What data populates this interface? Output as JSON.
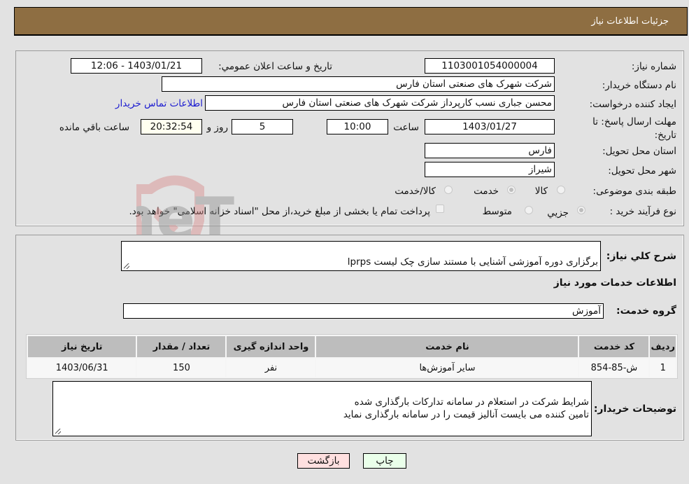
{
  "header": {
    "title": "جزئیات اطلاعات نیاز"
  },
  "fields": {
    "need_number_label": "شماره نیاز:",
    "need_number": "1103001054000004",
    "announce_label": "تاریخ و ساعت اعلان عمومي:",
    "announce_value": "1403/01/21 - 12:06",
    "buyer_org_label": "نام دستگاه خریدار:",
    "buyer_org": "شرکت شهرک های صنعتی استان فارس",
    "creator_label": "ایجاد کننده درخواست:",
    "creator": "محسن  جباری نسب کارپرداز شرکت شهرک های صنعتی استان فارس",
    "contact_link": "اطلاعات تماس خریدار",
    "deadline_label": "مهلت ارسال پاسخ: تا تاریخ:",
    "deadline_date": "1403/01/27",
    "time_label": "ساعت",
    "deadline_time": "10:00",
    "days_value": "5",
    "days_label": "روز و",
    "remaining_time": "20:32:54",
    "remaining_label": "ساعت باقي مانده",
    "province_label": "استان محل تحویل:",
    "province": "فارس",
    "city_label": "شهر محل تحویل:",
    "city": "شیراز",
    "category_label": "طبقه بندی موضوعی:",
    "category_options": [
      "کالا",
      "خدمت",
      "کالا/خدمت"
    ],
    "category_selected": "خدمت",
    "process_label": "نوع فرآیند خرید :",
    "process_options": [
      "جزیي",
      "متوسط"
    ],
    "process_selected": "جزیي",
    "treasury_note": "پرداخت تمام یا بخشی از مبلغ خرید،از محل \"اسناد خزانه اسلامی\" خواهد بود."
  },
  "description": {
    "label": "شرح کلي نیاز:",
    "value": "برگزاری دوره آموزشی آشنایی با مستند سازی چک لیست lprps"
  },
  "services": {
    "section_title": "اطلاعات خدمات مورد نیاز",
    "group_label": "گروه خدمت:",
    "group_value": "آموزش",
    "columns": [
      "ردیف",
      "کد خدمت",
      "نام خدمت",
      "واحد اندازه گیری",
      "تعداد / مقدار",
      "تاریخ نیاز"
    ],
    "rows": [
      [
        "1",
        "ش-85-854",
        "سایر آموزش‌ها",
        "نفر",
        "150",
        "1403/06/31"
      ]
    ]
  },
  "buyer_notes": {
    "label": "توضیحات خریدار:",
    "value": "شرایط شرکت در استعلام در سامانه تدارکات بارگذاری شده\nتامین کننده می بایست آنالیز قیمت را در سامانه بارگذاری نماید"
  },
  "buttons": {
    "print": "چاپ",
    "back": "بازگشت"
  },
  "watermark": {
    "text": "AriaTender.neT"
  },
  "colors": {
    "header_bg": "#8e6e42",
    "print_bg": "#eaffea",
    "back_bg": "#ffe0e0",
    "link": "#1a1ad0"
  }
}
